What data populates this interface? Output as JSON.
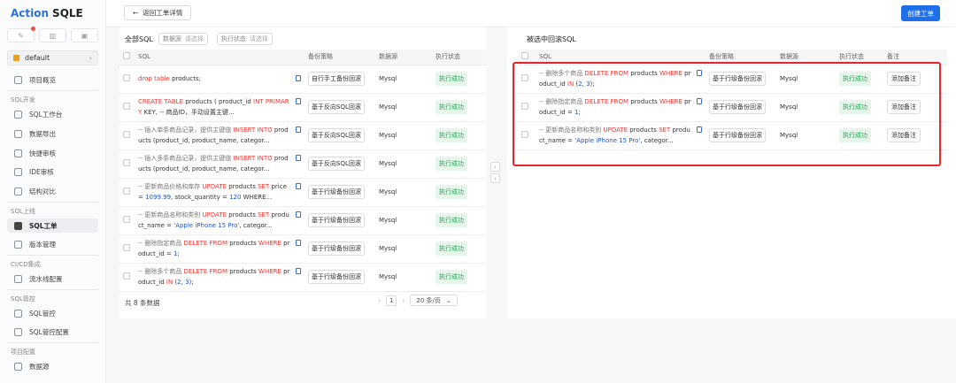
{
  "brand": {
    "part1": "Action",
    "part2": "SQLE"
  },
  "project": {
    "name": "default"
  },
  "nav": {
    "overview": "项目概览",
    "dev_section": "SQL开发",
    "workbench": "SQL工作台",
    "export": "数据导出",
    "quick_audit": "快捷审核",
    "ide_audit": "IDE审核",
    "struct_compare": "结构对比",
    "release_section": "SQL上线",
    "sql_ticket": "SQL工单",
    "version_mgmt": "版本管理",
    "cicd_section": "CI/CD集成",
    "pipeline": "流水线配置",
    "control_section": "SQL管控",
    "sql_control": "SQL管控",
    "sql_control_cfg": "SQL管控配置",
    "project_cfg_section": "项目配置",
    "datasource": "数据源"
  },
  "topbar": {
    "back_label": "返回工单详情",
    "create_label": "创建工单"
  },
  "left": {
    "title": "全部SQL",
    "filter_datasource": {
      "label": "数据源",
      "placeholder": "请选择"
    },
    "filter_status": {
      "label": "执行状态",
      "placeholder": "请选择"
    },
    "headers": {
      "sql": "SQL",
      "strategy": "备份策略",
      "datasource": "数据源",
      "status": "执行状态"
    },
    "rows": [
      {
        "parts": [
          {
            "t": "drop table",
            "c": "kw"
          },
          {
            "t": " products;",
            "c": ""
          }
        ],
        "strategy": "自行手工备份回滚",
        "datasource": "Mysql",
        "status": "执行成功"
      },
      {
        "parts": [
          {
            "t": "CREATE TABLE",
            "c": "kw"
          },
          {
            "t": " products ( product_id ",
            "c": ""
          },
          {
            "t": "INT PRIMARY",
            "c": "kw"
          },
          {
            "t": " KEY, -- 商品ID，手动设置主键...",
            "c": ""
          }
        ],
        "strategy": "基于反向SQL回滚",
        "datasource": "Mysql",
        "status": "执行成功"
      },
      {
        "parts": [
          {
            "t": "-- 插入单条商品记录，提供主键值 ",
            "c": "cm"
          },
          {
            "t": "INSERT INTO",
            "c": "kw"
          },
          {
            "t": " products (product_id, product_name, categor...",
            "c": ""
          }
        ],
        "strategy": "基于反向SQL回滚",
        "datasource": "Mysql",
        "status": "执行成功"
      },
      {
        "parts": [
          {
            "t": "-- 插入多条商品记录，提供主键值 ",
            "c": "cm"
          },
          {
            "t": "INSERT INTO",
            "c": "kw"
          },
          {
            "t": " products (product_id, product_name, categor...",
            "c": ""
          }
        ],
        "strategy": "基于反向SQL回滚",
        "datasource": "Mysql",
        "status": "执行成功"
      },
      {
        "parts": [
          {
            "t": "-- 更新商品价格和库存 ",
            "c": "cm"
          },
          {
            "t": "UPDATE",
            "c": "kw"
          },
          {
            "t": " products ",
            "c": ""
          },
          {
            "t": "SET",
            "c": "kw"
          },
          {
            "t": " price = ",
            "c": ""
          },
          {
            "t": "1099.99",
            "c": "nm"
          },
          {
            "t": ", stock_quantity = ",
            "c": ""
          },
          {
            "t": "120",
            "c": "nm"
          },
          {
            "t": " WHERE...",
            "c": ""
          }
        ],
        "strategy": "基于行级备份回滚",
        "datasource": "Mysql",
        "status": "执行成功"
      },
      {
        "parts": [
          {
            "t": "-- 更新商品名称和类别 ",
            "c": "cm"
          },
          {
            "t": "UPDATE",
            "c": "kw"
          },
          {
            "t": " products ",
            "c": ""
          },
          {
            "t": "SET",
            "c": "kw"
          },
          {
            "t": " product_name = ",
            "c": ""
          },
          {
            "t": "'Apple iPhone 15 Pro'",
            "c": "st"
          },
          {
            "t": ", categor...",
            "c": ""
          }
        ],
        "strategy": "基于行级备份回滚",
        "datasource": "Mysql",
        "status": "执行成功"
      },
      {
        "parts": [
          {
            "t": "-- 删除指定商品 ",
            "c": "cm"
          },
          {
            "t": "DELETE FROM",
            "c": "kw"
          },
          {
            "t": " products ",
            "c": ""
          },
          {
            "t": "WHERE",
            "c": "kw"
          },
          {
            "t": " product_id = ",
            "c": ""
          },
          {
            "t": "1",
            "c": "nm"
          },
          {
            "t": ";",
            "c": ""
          }
        ],
        "strategy": "基于行级备份回滚",
        "datasource": "Mysql",
        "status": "执行成功"
      },
      {
        "parts": [
          {
            "t": "-- 删除多个商品 ",
            "c": "cm"
          },
          {
            "t": "DELETE FROM",
            "c": "kw"
          },
          {
            "t": " products ",
            "c": ""
          },
          {
            "t": "WHERE",
            "c": "kw"
          },
          {
            "t": " product_id ",
            "c": ""
          },
          {
            "t": "IN",
            "c": "kw"
          },
          {
            "t": " (",
            "c": ""
          },
          {
            "t": "2",
            "c": "nm"
          },
          {
            "t": ", ",
            "c": ""
          },
          {
            "t": "3",
            "c": "nm"
          },
          {
            "t": ");",
            "c": ""
          }
        ],
        "strategy": "基于行级备份回滚",
        "datasource": "Mysql",
        "status": "执行成功"
      }
    ],
    "total": "共 8 条数据",
    "page": "1",
    "page_size": "20 条/页"
  },
  "right": {
    "title": "被选中回滚SQL",
    "headers": {
      "sql": "SQL",
      "strategy": "备份策略",
      "datasource": "数据源",
      "status": "执行状态",
      "note": "备注"
    },
    "rows": [
      {
        "parts": [
          {
            "t": "-- 删除多个商品 ",
            "c": "cm"
          },
          {
            "t": "DELETE FROM",
            "c": "kw"
          },
          {
            "t": " products ",
            "c": ""
          },
          {
            "t": "WHERE",
            "c": "kw"
          },
          {
            "t": " product_id ",
            "c": ""
          },
          {
            "t": "IN",
            "c": "kw"
          },
          {
            "t": " (",
            "c": ""
          },
          {
            "t": "2",
            "c": "nm"
          },
          {
            "t": ", ",
            "c": ""
          },
          {
            "t": "3",
            "c": "nm"
          },
          {
            "t": ");",
            "c": ""
          }
        ],
        "strategy": "基于行级备份回滚",
        "datasource": "Mysql",
        "status": "执行成功",
        "note": "添加备注"
      },
      {
        "parts": [
          {
            "t": "-- 删除指定商品 ",
            "c": "cm"
          },
          {
            "t": "DELETE FROM",
            "c": "kw"
          },
          {
            "t": " products ",
            "c": ""
          },
          {
            "t": "WHERE",
            "c": "kw"
          },
          {
            "t": " product_id = ",
            "c": ""
          },
          {
            "t": "1",
            "c": "nm"
          },
          {
            "t": ";",
            "c": ""
          }
        ],
        "strategy": "基于行级备份回滚",
        "datasource": "Mysql",
        "status": "执行成功",
        "note": "添加备注"
      },
      {
        "parts": [
          {
            "t": "-- 更新商品名称和类别 ",
            "c": "cm"
          },
          {
            "t": "UPDATE",
            "c": "kw"
          },
          {
            "t": " products ",
            "c": ""
          },
          {
            "t": "SET",
            "c": "kw"
          },
          {
            "t": " product_name = ",
            "c": ""
          },
          {
            "t": "'Apple iPhone 15 Pro'",
            "c": "st"
          },
          {
            "t": ", categor...",
            "c": ""
          }
        ],
        "strategy": "基于行级备份回滚",
        "datasource": "Mysql",
        "status": "执行成功",
        "note": "添加备注"
      }
    ]
  },
  "colors": {
    "accent": "#1f6feb",
    "keyword": "#e53935",
    "success_bg": "#e4f7ea",
    "success_text": "#27a653",
    "highlight_border": "#e8242b"
  }
}
